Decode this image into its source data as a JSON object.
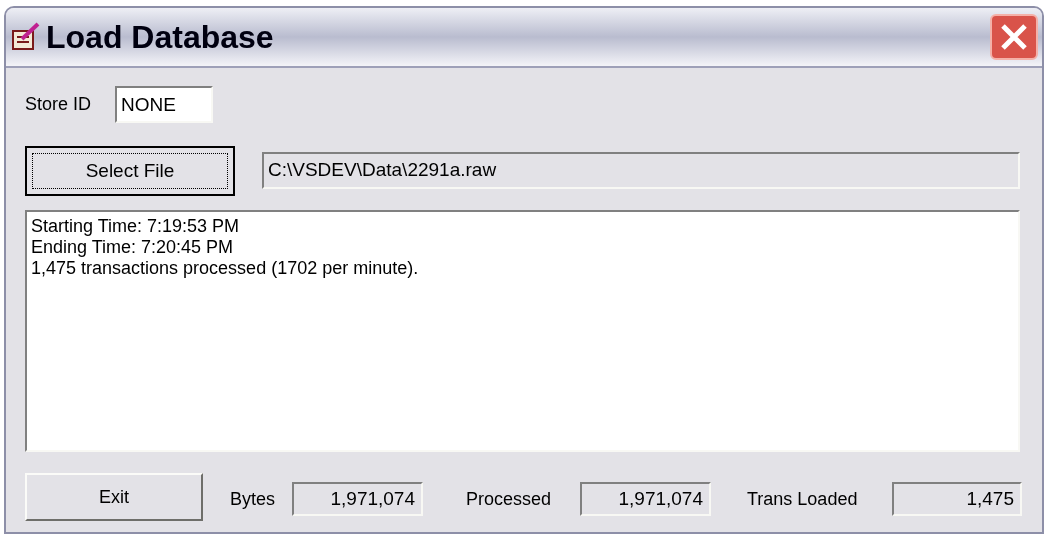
{
  "window": {
    "title": "Load Database"
  },
  "store_id": {
    "label": "Store ID",
    "value": "NONE"
  },
  "select_file_button": "Select File",
  "file_path": "C:\\VSDEV\\Data\\2291a.raw",
  "log": [
    "Starting Time: 7:19:53 PM",
    "Ending Time: 7:20:45 PM",
    "1,475 transactions processed (1702 per minute)."
  ],
  "exit_button": "Exit",
  "counters": [
    {
      "label": "Bytes",
      "value": "1,971,074"
    },
    {
      "label": "Processed",
      "value": "1,971,074"
    },
    {
      "label": "Trans Loaded",
      "value": "1,475"
    }
  ]
}
